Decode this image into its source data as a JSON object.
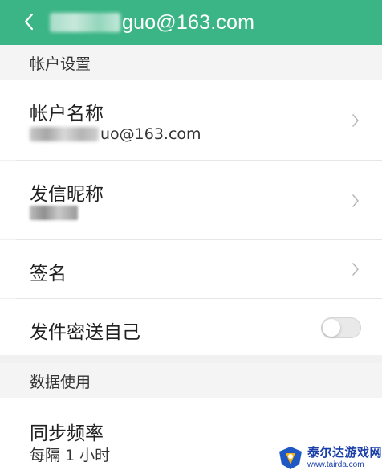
{
  "header": {
    "title_suffix": "guo@163.com",
    "background_color": "#3bb586"
  },
  "sections": {
    "account_settings": "帐户设置",
    "data_usage": "数据使用"
  },
  "rows": {
    "account_name": {
      "title": "帐户名称",
      "value_suffix": "uo@163.com"
    },
    "nickname": {
      "title": "发信昵称"
    },
    "signature": {
      "title": "签名"
    },
    "bcc_self": {
      "title": "发件密送自己",
      "toggle_on": false
    },
    "sync_frequency": {
      "title": "同步频率",
      "value": "每隔 1 小时"
    }
  },
  "icons": {
    "back": "chevron-left-icon",
    "row_arrow": "chevron-right-icon"
  },
  "watermark": {
    "name": "泰尔达游戏网",
    "url": "www.tairda.com"
  }
}
